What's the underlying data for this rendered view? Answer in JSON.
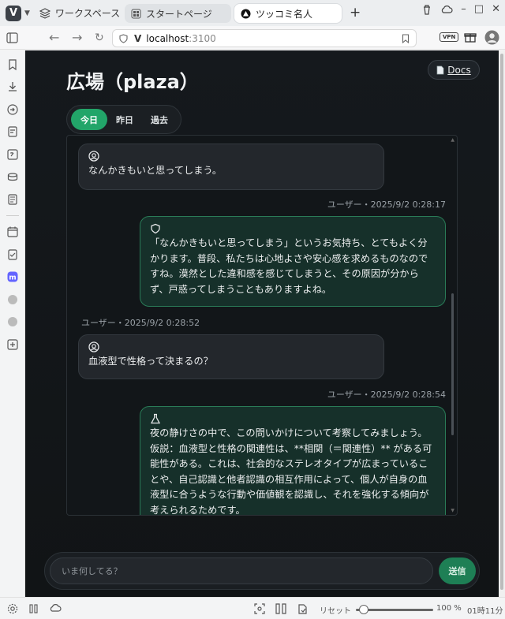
{
  "browser": {
    "workspace_label": "ワークスペース",
    "tabs": [
      {
        "label": "スタートページ"
      },
      {
        "label": "ツッコミ名人"
      }
    ],
    "url_host": "localhost",
    "url_port": ":3100",
    "vpn_label": "VPN"
  },
  "status": {
    "reset_label": "リセット",
    "zoom": "100 %",
    "zoom_fraction": 0.1,
    "clock": "01時11分"
  },
  "page": {
    "title": "広場（plaza）",
    "docs_label": "Docs",
    "tabs": [
      {
        "label": "今日"
      },
      {
        "label": "昨日"
      },
      {
        "label": "過去"
      }
    ]
  },
  "messages": [
    {
      "role": "user",
      "icon": "user-circle-icon",
      "text": "なんかきもいと思ってしまう。"
    },
    {
      "role": "meta",
      "text": "ユーザー・2025/9/2 0:28:17"
    },
    {
      "role": "bot",
      "icon": "shield-icon",
      "text": "「なんかきもいと思ってしまう」というお気持ち、とてもよく分かります。普段、私たちは心地よさや安心感を求めるものなのですね。漠然とした違和感を感じてしまうと、その原因が分からず、戸惑ってしまうこともありますよね。"
    },
    {
      "role": "meta",
      "text": "ユーザー・2025/9/2 0:28:52"
    },
    {
      "role": "user",
      "icon": "user-circle-icon",
      "text": "血液型で性格って決まるの？"
    },
    {
      "role": "meta",
      "text": "ユーザー・2025/9/2 0:28:54"
    },
    {
      "role": "bot",
      "icon": "flask-icon",
      "text": "夜の静けさの中で、この問いかけについて考察してみましょう。仮説：血液型と性格の関連性は、**相関（＝関連性）** がある可能性がある。これは、社会的なステレオタイプが広まっていることや、自己認識と他者認識の相互作用によって、個人が自身の血液型に合うような行動や価値観を認識し、それを強化する傾向が考えられるためです。"
    }
  ],
  "composer": {
    "placeholder": "いま何してる？",
    "send_label": "送信"
  }
}
